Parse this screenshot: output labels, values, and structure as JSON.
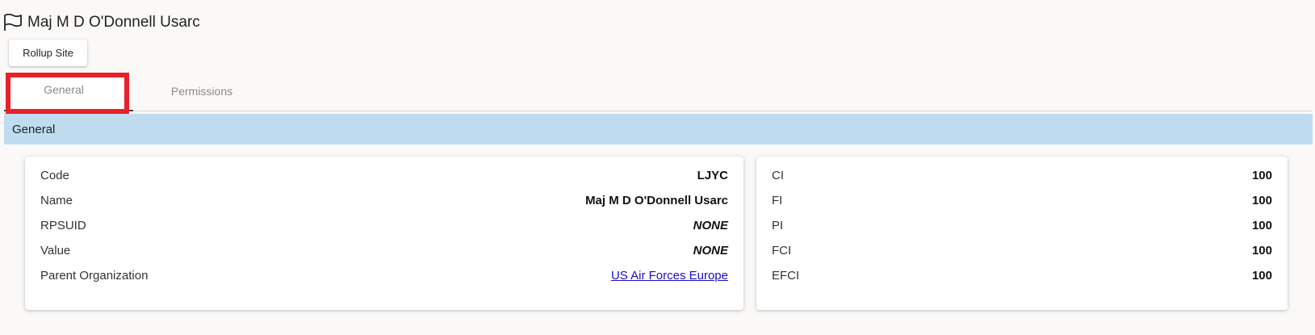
{
  "header": {
    "title": "Maj M D O'Donnell Usarc",
    "icon": "flag-icon",
    "rollup_button_label": "Rollup Site"
  },
  "tabs": [
    {
      "label": "General",
      "active": true
    },
    {
      "label": "Permissions",
      "active": false
    }
  ],
  "section": {
    "title": "General"
  },
  "details": {
    "code": {
      "label": "Code",
      "value": "LJYC"
    },
    "name": {
      "label": "Name",
      "value": "Maj M D O'Donnell Usarc"
    },
    "rpsuid": {
      "label": "RPSUID",
      "value": "NONE"
    },
    "value": {
      "label": "Value",
      "value": "NONE"
    },
    "parent_org": {
      "label": "Parent Organization",
      "value": "US Air Forces Europe"
    }
  },
  "indices": {
    "ci": {
      "label": "CI",
      "value": "100"
    },
    "fi": {
      "label": "FI",
      "value": "100"
    },
    "pi": {
      "label": "PI",
      "value": "100"
    },
    "fci": {
      "label": "FCI",
      "value": "100"
    },
    "efci": {
      "label": "EFCI",
      "value": "100"
    }
  },
  "colors": {
    "section_bar": "#bfdcf1",
    "highlight_border": "#e8202a",
    "link": "#1a0dcc"
  }
}
